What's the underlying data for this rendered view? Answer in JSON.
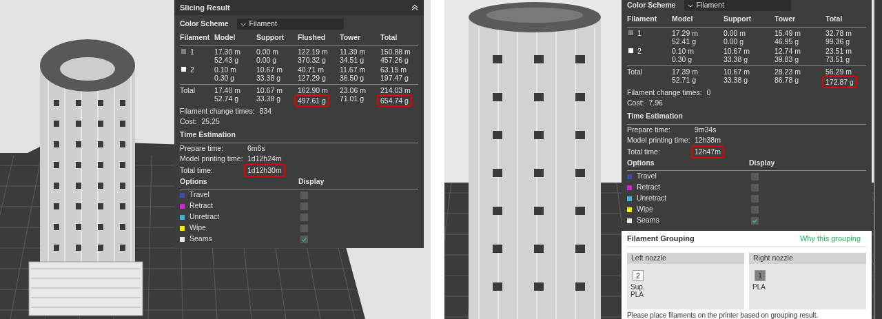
{
  "views": [
    {
      "slicing_result": {
        "title": "Slicing Result",
        "color_scheme": {
          "label": "Color Scheme",
          "value": "Filament"
        },
        "columns": [
          "Filament",
          "Model",
          "Support",
          "Flushed",
          "Tower",
          "Total"
        ],
        "filaments": [
          {
            "id": "1",
            "color": "#808080",
            "cells": [
              {
                "length": "17.30 m",
                "weight": "52.43 g",
                "highlighted": false
              },
              {
                "length": "0.00 m",
                "weight": "0.00 g",
                "highlighted": false
              },
              {
                "length": "122.19 m",
                "weight": "370.32 g",
                "highlighted": false
              },
              {
                "length": "11.39 m",
                "weight": "34.51 g",
                "highlighted": false
              },
              {
                "length": "150.88 m",
                "weight": "457.26 g",
                "highlighted": false
              }
            ]
          },
          {
            "id": "2",
            "color": "#ffffff",
            "cells": [
              {
                "length": "0.10 m",
                "weight": "0.30 g",
                "highlighted": false
              },
              {
                "length": "10.67 m",
                "weight": "33.38 g",
                "highlighted": false
              },
              {
                "length": "40.71 m",
                "weight": "127.29 g",
                "highlighted": false
              },
              {
                "length": "11.67 m",
                "weight": "36.50 g",
                "highlighted": false
              },
              {
                "length": "63.15 m",
                "weight": "197.47 g",
                "highlighted": false
              }
            ]
          }
        ],
        "total": {
          "label": "Total",
          "cells": [
            {
              "length": "17.40 m",
              "weight": "52.74 g",
              "highlighted": false
            },
            {
              "length": "10.67 m",
              "weight": "33.38 g",
              "highlighted": false
            },
            {
              "length": "162.90 m",
              "weight": "497.61 g",
              "highlighted": true
            },
            {
              "length": "23.06 m",
              "weight": "71.01 g",
              "highlighted": false
            },
            {
              "length": "214.03 m",
              "weight": "654.74 g",
              "highlighted": true
            }
          ]
        },
        "change_times": {
          "label": "Filament change times:",
          "value": "834"
        },
        "cost": {
          "label": "Cost:",
          "value": "25.25"
        },
        "time_estimation": {
          "title": "Time Estimation",
          "rows": [
            {
              "label": "Prepare time:",
              "value": "6m6s",
              "highlighted": false
            },
            {
              "label": "Model printing time:",
              "value": "1d12h24m",
              "highlighted": false
            },
            {
              "label": "Total time:",
              "value": "1d12h30m",
              "highlighted": true
            }
          ]
        },
        "options": {
          "title": "Options",
          "display_title": "Display",
          "items": [
            {
              "label": "Travel",
              "color": "#3c4ca8",
              "checked": false
            },
            {
              "label": "Retract",
              "color": "#d026d0",
              "checked": false
            },
            {
              "label": "Unretract",
              "color": "#3fb0d6",
              "checked": false
            },
            {
              "label": "Wipe",
              "color": "#f2f200",
              "checked": false
            },
            {
              "label": "Seams",
              "color": "#e8e8e8",
              "checked": true
            }
          ]
        }
      }
    },
    {
      "slicing_result": {
        "color_scheme": {
          "label": "Color Scheme",
          "value": "Filament"
        },
        "columns": [
          "Filament",
          "Model",
          "Support",
          "Tower",
          "Total"
        ],
        "filaments": [
          {
            "id": "1",
            "color": "#808080",
            "cells": [
              {
                "length": "17.29 m",
                "weight": "52.41 g",
                "highlighted": false
              },
              {
                "length": "0.00 m",
                "weight": "0.00 g",
                "highlighted": false
              },
              {
                "length": "15.49 m",
                "weight": "46.95 g",
                "highlighted": false
              },
              {
                "length": "32.78 m",
                "weight": "99.36 g",
                "highlighted": false
              }
            ]
          },
          {
            "id": "2",
            "color": "#ffffff",
            "cells": [
              {
                "length": "0.10 m",
                "weight": "0.30 g",
                "highlighted": false
              },
              {
                "length": "10.67 m",
                "weight": "33.38 g",
                "highlighted": false
              },
              {
                "length": "12.74 m",
                "weight": "39.83 g",
                "highlighted": false
              },
              {
                "length": "23.51 m",
                "weight": "73.51 g",
                "highlighted": false
              }
            ]
          }
        ],
        "total": {
          "label": "Total",
          "cells": [
            {
              "length": "17.39 m",
              "weight": "52.71 g",
              "highlighted": false
            },
            {
              "length": "10.67 m",
              "weight": "33.38 g",
              "highlighted": false
            },
            {
              "length": "28.23 m",
              "weight": "86.78 g",
              "highlighted": false
            },
            {
              "length": "56.29 m",
              "weight": "172.87 g",
              "highlighted": true
            }
          ]
        },
        "change_times": {
          "label": "Filament change times:",
          "value": "0"
        },
        "cost": {
          "label": "Cost:",
          "value": "7.96"
        },
        "time_estimation": {
          "title": "Time Estimation",
          "rows": [
            {
              "label": "Prepare time:",
              "value": "9m34s",
              "highlighted": false
            },
            {
              "label": "Model printing time:",
              "value": "12h38m",
              "highlighted": false
            },
            {
              "label": "Total time:",
              "value": "12h47m",
              "highlighted": true
            }
          ]
        },
        "options": {
          "title": "Options",
          "display_title": "Display",
          "items": [
            {
              "label": "Travel",
              "color": "#3c4ca8",
              "checked": false
            },
            {
              "label": "Retract",
              "color": "#d026d0",
              "checked": false
            },
            {
              "label": "Unretract",
              "color": "#3fb0d6",
              "checked": false
            },
            {
              "label": "Wipe",
              "color": "#f2f200",
              "checked": false
            },
            {
              "label": "Seams",
              "color": "#e8e8e8",
              "checked": true
            }
          ]
        }
      },
      "filament_grouping": {
        "title": "Filament Grouping",
        "link": "Why this grouping",
        "nozzles": [
          {
            "title": "Left nozzle",
            "filaments": [
              {
                "id": "2",
                "color": "#ffffff",
                "label": "Sup. PLA"
              }
            ]
          },
          {
            "title": "Right nozzle",
            "filaments": [
              {
                "id": "1",
                "color": "#808080",
                "label": "PLA"
              }
            ]
          }
        ],
        "note": "Please place filaments on the printer based on grouping result."
      }
    }
  ]
}
